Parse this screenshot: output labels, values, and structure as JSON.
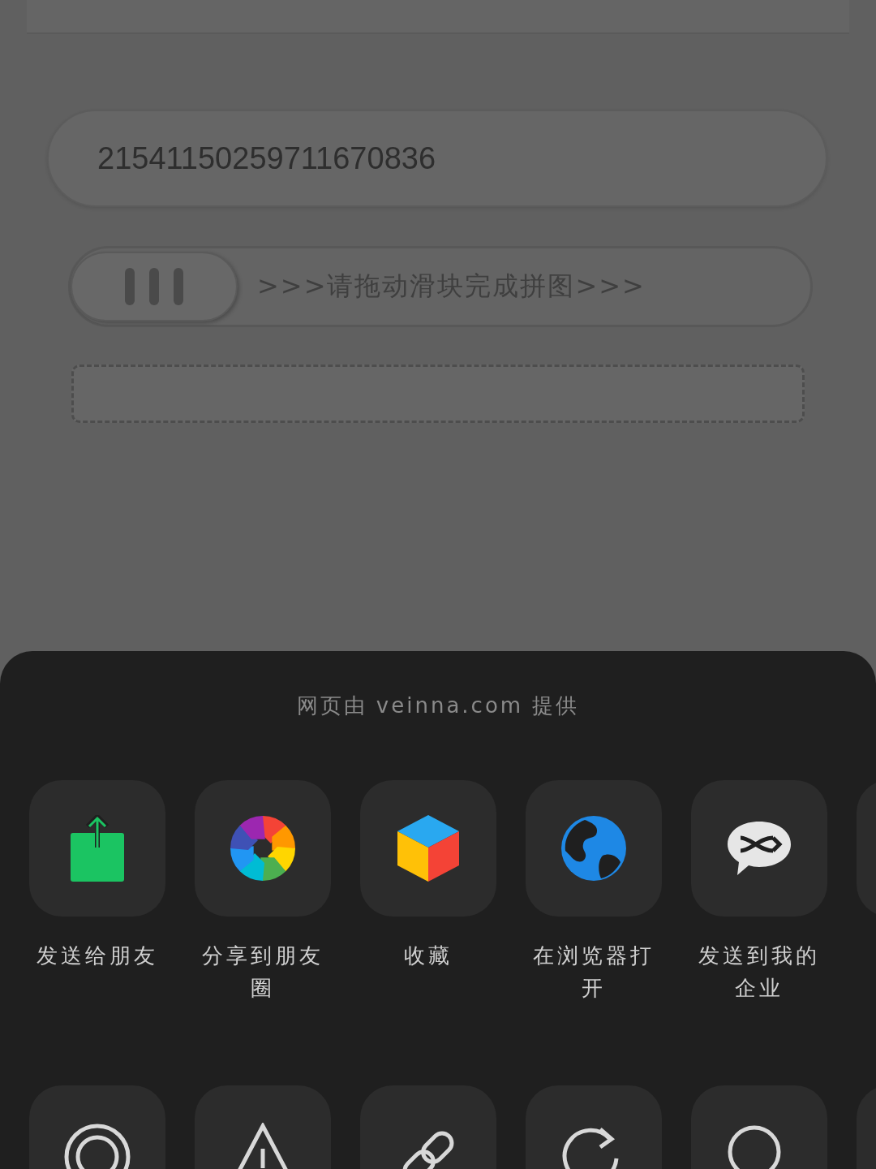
{
  "page": {
    "code_field": {
      "value": "21541150259711670836"
    },
    "slider": {
      "hint": ">>>请拖动滑块完成拼图>>>"
    }
  },
  "share_sheet": {
    "provider": "网页由 veinna.com 提供",
    "actions": [
      {
        "label": "发送给朋友"
      },
      {
        "label": "分享到朋友圈"
      },
      {
        "label": "收藏"
      },
      {
        "label": "在浏览器打开"
      },
      {
        "label": "发送到我的企业"
      }
    ]
  }
}
